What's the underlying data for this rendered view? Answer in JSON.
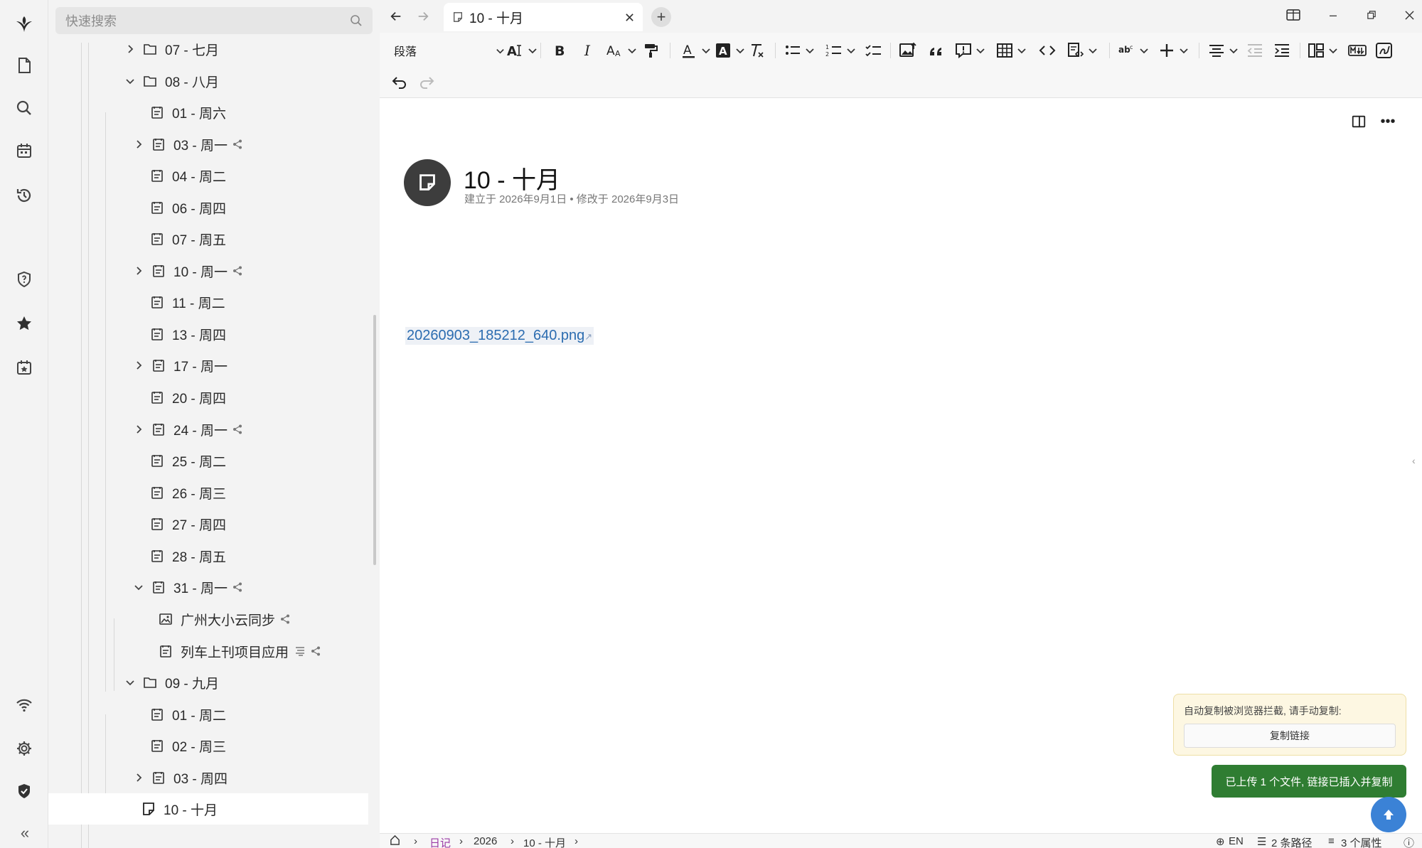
{
  "search": {
    "placeholder": "快速搜索"
  },
  "tree": {
    "items": [
      {
        "label": "07 - 七月",
        "type": "folder"
      },
      {
        "label": "08 - 八月",
        "type": "folder"
      },
      {
        "label": "01 - 周六",
        "type": "note"
      },
      {
        "label": "03 - 周一",
        "type": "note"
      },
      {
        "label": "04 - 周二",
        "type": "note"
      },
      {
        "label": "06 - 周四",
        "type": "note"
      },
      {
        "label": "07 - 周五",
        "type": "note"
      },
      {
        "label": "10 - 周一",
        "type": "note"
      },
      {
        "label": "11 - 周二",
        "type": "note"
      },
      {
        "label": "13 - 周四",
        "type": "note"
      },
      {
        "label": "17 - 周一",
        "type": "note"
      },
      {
        "label": "20 - 周四",
        "type": "note"
      },
      {
        "label": "24 - 周一",
        "type": "note"
      },
      {
        "label": "25 - 周二",
        "type": "note"
      },
      {
        "label": "26 - 周三",
        "type": "note"
      },
      {
        "label": "27 - 周四",
        "type": "note"
      },
      {
        "label": "28 - 周五",
        "type": "note"
      },
      {
        "label": "31 - 周一",
        "type": "note"
      },
      {
        "label": "广州大小云同步",
        "type": "image"
      },
      {
        "label": "列车上刊项目应用",
        "type": "note"
      },
      {
        "label": "09 - 九月",
        "type": "folder"
      },
      {
        "label": "01 - 周二",
        "type": "note"
      },
      {
        "label": "02 - 周三",
        "type": "note"
      },
      {
        "label": "03 - 周四",
        "type": "note"
      },
      {
        "label": "10 - 十月",
        "type": "note"
      }
    ]
  },
  "tab": {
    "label": "10 - 十月"
  },
  "toolbar": {
    "block_type": "段落"
  },
  "document": {
    "title": "10 - 十月",
    "meta": "建立于 2026年9月1日 • 修改于 2026年9月3日",
    "link_text": "20260903_185212_640.png"
  },
  "notice": {
    "message": "自动复制被浏览器拦截, 请手动复制:",
    "copy_button": "复制链接",
    "toast": "已上传 1 个文件, 链接已插入并复制"
  },
  "status": {
    "breadcrumb": [
      "日记",
      "2026",
      "10 - 十月"
    ],
    "language": "EN",
    "paths": "2 条路径",
    "attributes": "3 个属性"
  },
  "colors": {
    "accent_link": "#2b6cb0",
    "toast_bg": "#2f7d32",
    "scroll_top_bg": "#3b82d6",
    "breadcrumb_active": "#9b3aa6"
  },
  "icons": {
    "rail": [
      "app-logo-icon",
      "file-icon",
      "search-icon",
      "calendar-icon",
      "history-icon",
      "shield-question-icon",
      "star-icon",
      "calendar-star-icon",
      "wifi-icon",
      "gear-icon",
      "shield-check-icon"
    ]
  }
}
